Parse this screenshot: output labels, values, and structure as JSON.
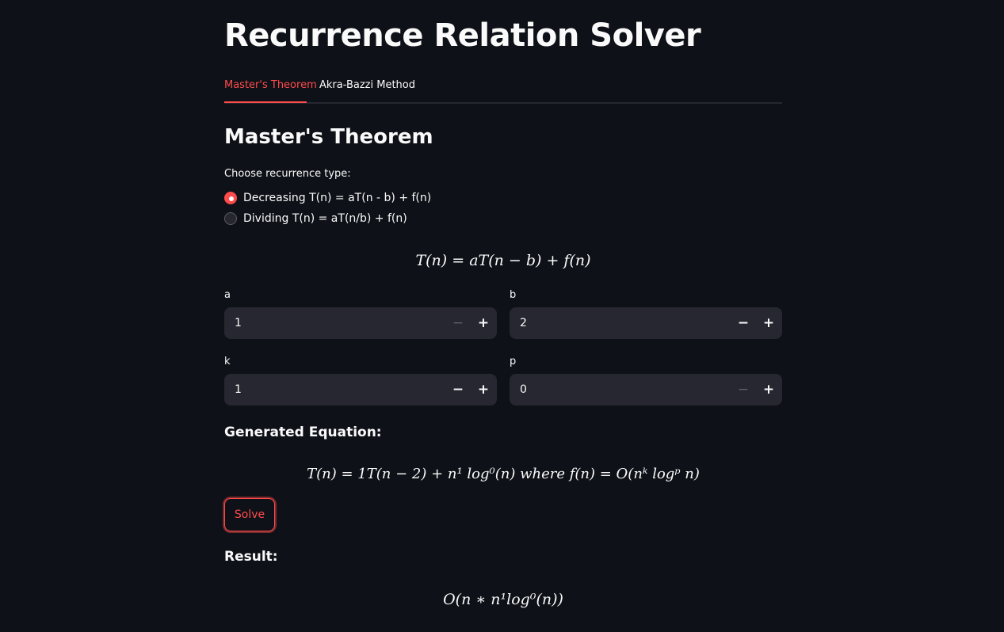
{
  "app": {
    "title": "Recurrence Relation Solver"
  },
  "tabs": [
    {
      "label": "Master's Theorem",
      "active": true
    },
    {
      "label": "Akra-Bazzi Method",
      "active": false
    }
  ],
  "section": {
    "title": "Master's Theorem"
  },
  "recurrence_type": {
    "label": "Choose recurrence type:",
    "options": [
      {
        "label": "Decreasing T(n) = aT(n - b) + f(n)",
        "selected": true
      },
      {
        "label": "Dividing T(n) = aT(n/b) + f(n)",
        "selected": false
      }
    ]
  },
  "formula": "T(n) = aT(n − b) + f(n)",
  "inputs": {
    "a": {
      "label": "a",
      "value": "1",
      "minus_disabled": true
    },
    "b": {
      "label": "b",
      "value": "2",
      "minus_disabled": false
    },
    "k": {
      "label": "k",
      "value": "1",
      "minus_disabled": false
    },
    "p": {
      "label": "p",
      "value": "0",
      "minus_disabled": true
    }
  },
  "stepper": {
    "minus": "−",
    "plus": "+"
  },
  "generated": {
    "heading": "Generated Equation:",
    "equation": "T(n) = 1T(n − 2) + n¹ log⁰(n) where f(n) = O(nᵏ logᵖ n)"
  },
  "solve_button": {
    "label": "Solve"
  },
  "result": {
    "heading": "Result:",
    "expression": "O(n ∗ n¹log⁰(n))"
  },
  "colors": {
    "accent": "#ff4b4b",
    "background": "#0e1117",
    "input_bg": "#262730"
  }
}
